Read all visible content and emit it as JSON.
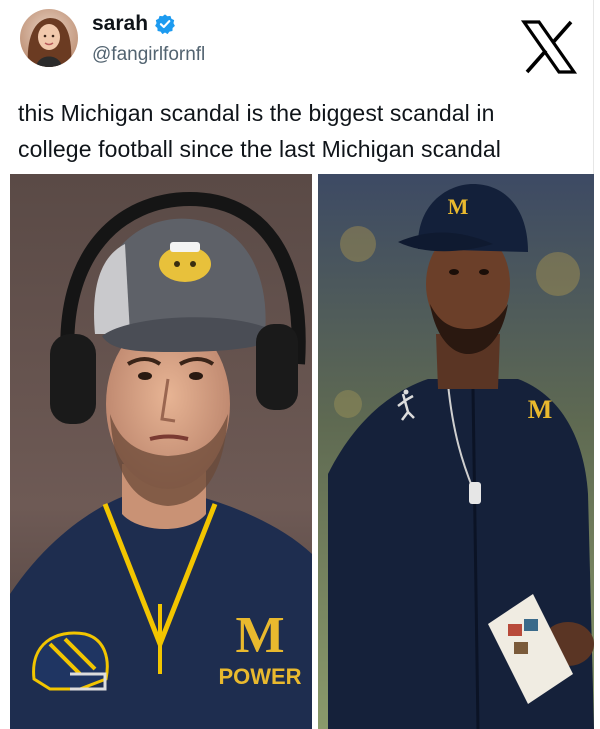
{
  "user": {
    "display_name": "sarah",
    "handle": "@fangirlfornfl",
    "verified_icon": "verified-badge-icon",
    "avatar_icon": "avatar"
  },
  "brand": {
    "logo_icon": "x-logo-icon"
  },
  "tweet": {
    "line1": "this Michigan scandal is the biggest scandal in",
    "line2": "college football since the last Michigan scandal"
  },
  "photos": {
    "left": {
      "cap_logo": "wolverine-logo",
      "shirt_letter": "M",
      "shirt_word": "POWER",
      "helmet_icon": "michigan-helmet-icon"
    },
    "right": {
      "cap_letter": "M",
      "shirt_letter": "M",
      "brand_icon": "jumpman-icon"
    }
  },
  "colors": {
    "verified_blue": "#1d9bf0",
    "michigan_navy": "#00274c",
    "michigan_maize": "#ffcb05",
    "handle_gray": "#536471"
  }
}
